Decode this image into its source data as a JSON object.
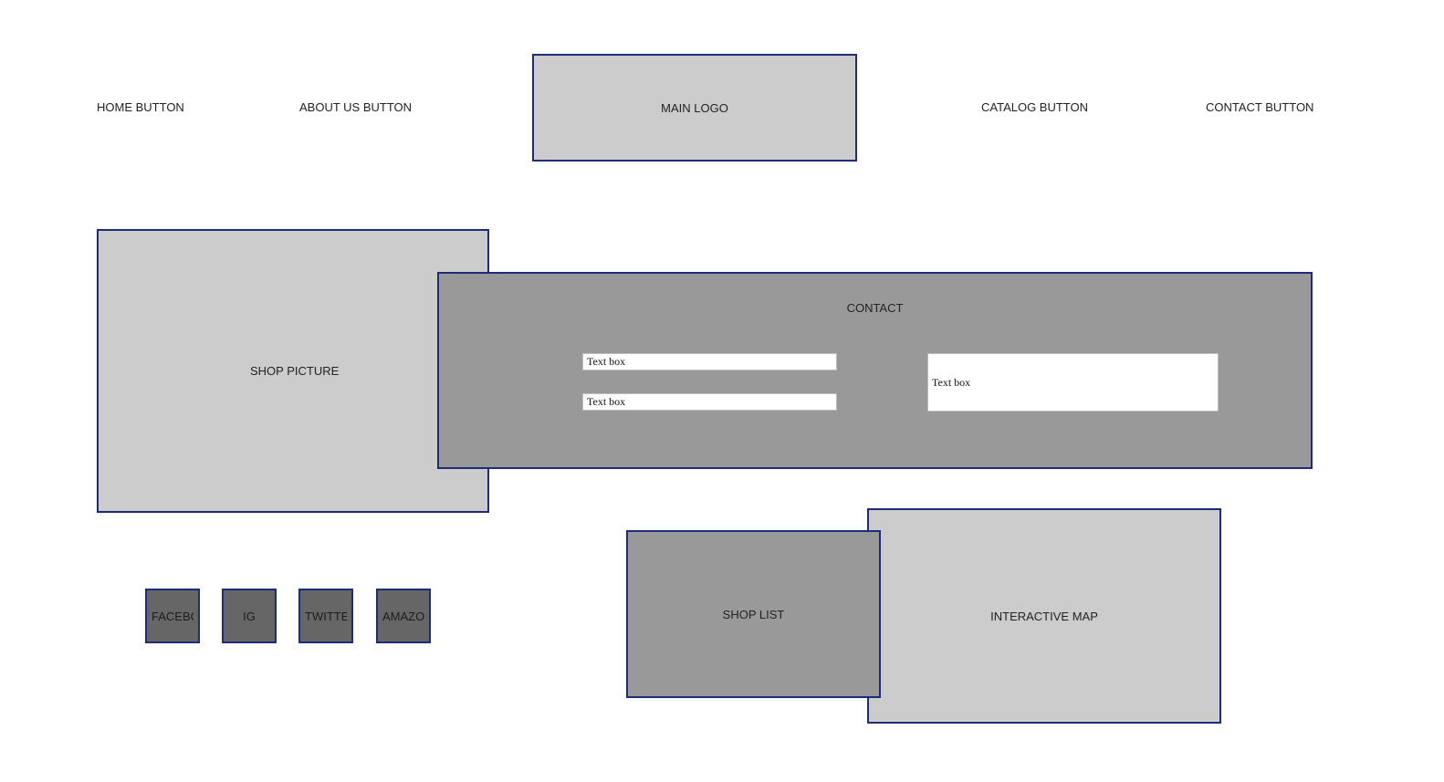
{
  "nav": {
    "home": "HOME BUTTON",
    "about": "ABOUT US BUTTON",
    "logo": "MAIN LOGO",
    "catalog": "CATALOG BUTTON",
    "contact": "CONTACT BUTTON"
  },
  "shop_picture": "SHOP PICTURE",
  "contact_panel": {
    "title": "CONTACT",
    "field_1": "Text box",
    "field_2": "Text box",
    "field_3": "Text box"
  },
  "social": {
    "facebook": "FACEBOOK",
    "ig": "IG",
    "twitter": "TWITTER",
    "amazon": "AMAZON"
  },
  "shop_list": "SHOP LIST",
  "interactive_map": "INTERACTIVE MAP",
  "colors": {
    "border": "#1e2b7a",
    "light_gray": "#cccccc",
    "mid_gray": "#999999",
    "dark_gray": "#666666"
  }
}
